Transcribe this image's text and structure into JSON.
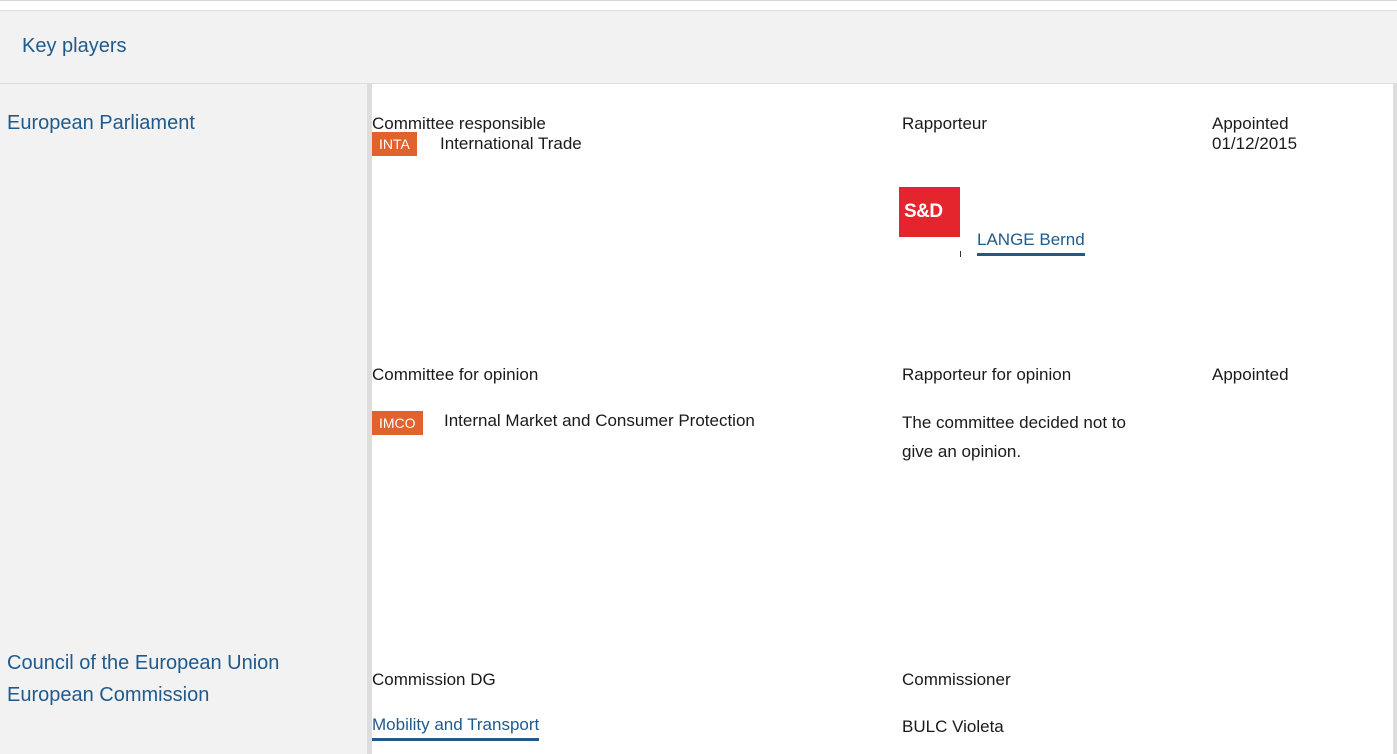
{
  "section": {
    "title": "Key players"
  },
  "institutions": {
    "ep": "European Parliament",
    "council": "Council of the European Union",
    "commission": "European Commission"
  },
  "responsible": {
    "col_committee": "Committee responsible",
    "col_rapporteur": "Rapporteur",
    "col_appointed": "Appointed",
    "committee_code": "INTA",
    "committee_name": "International Trade",
    "appointed_date": "01/12/2015",
    "group_logo_text": "S&D",
    "rapporteur_name": "LANGE Bernd"
  },
  "opinion": {
    "col_committee": "Committee for opinion",
    "col_rapporteur": "Rapporteur for opinion",
    "col_appointed": "Appointed",
    "committee_code": "IMCO",
    "committee_name": "Internal Market and Consumer Protection",
    "note_line1": "The committee decided not to",
    "note_line2": "give an opinion."
  },
  "commission": {
    "col_dg": "Commission DG",
    "col_commissioner": "Commissioner",
    "dg_name": "Mobility and Transport",
    "commissioner_name": "BULC Violeta"
  },
  "colors": {
    "link": "#1f5a8c",
    "badge": "#e0622c",
    "sd_logo": "#e5252d",
    "panel": "#f2f2f2"
  }
}
